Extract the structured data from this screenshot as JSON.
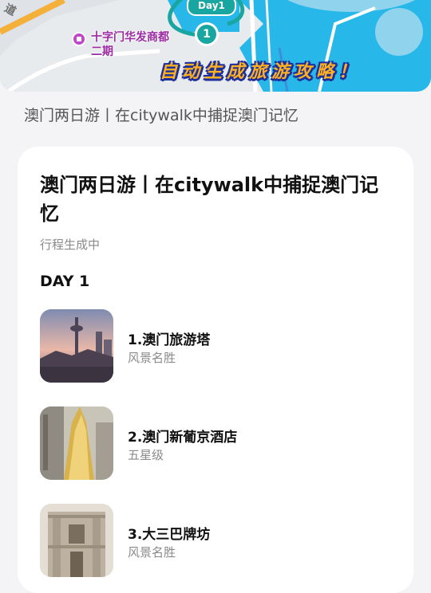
{
  "map": {
    "road_label": "道",
    "poi_label": "十字门华发商都二期",
    "day_chip": "Day1",
    "marker_number": "1",
    "banner": "自动生成旅游攻略！"
  },
  "subtitle": "澳门两日游丨在citywalk中捕捉澳门记忆",
  "card": {
    "title": "澳门两日游丨在citywalk中捕捉澳门记忆",
    "status": "行程生成中",
    "day_label": "DAY 1",
    "items": [
      {
        "name": "1.澳门旅游塔",
        "category": "风景名胜"
      },
      {
        "name": "2.澳门新葡京酒店",
        "category": "五星级"
      },
      {
        "name": "3.大三巴牌坊",
        "category": "风景名胜"
      }
    ]
  },
  "colors": {
    "accent": "#1aa6a0",
    "banner_fill": "#ffb020",
    "banner_outline": "#1c2f9c",
    "water": "#27b7e8",
    "poi": "#c246c8"
  }
}
